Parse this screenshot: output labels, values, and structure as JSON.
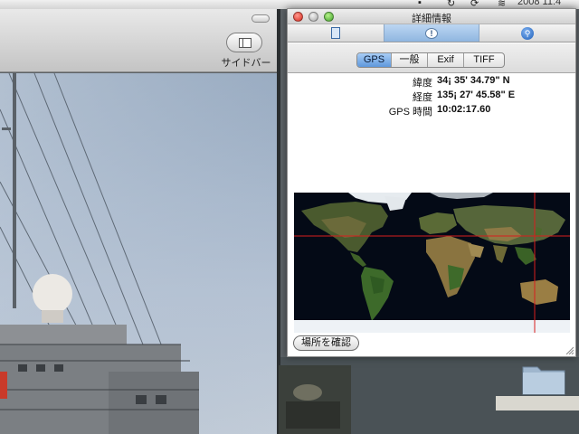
{
  "menubar": {
    "clock": "2008 11:4"
  },
  "preview": {
    "sidebar_label": "サイドバー"
  },
  "inspector": {
    "title": "詳細情報",
    "tabs": [
      "general-info",
      "more-info",
      "keywords"
    ],
    "segments": [
      {
        "label": "GPS",
        "active": true
      },
      {
        "label": "一般",
        "active": false
      },
      {
        "label": "Exif",
        "active": false
      },
      {
        "label": "TIFF",
        "active": false
      }
    ],
    "gps": [
      {
        "key": "緯度",
        "value": "34¡ 35' 34.79\" N"
      },
      {
        "key": "経度",
        "value": "135¡ 27' 45.58\" E"
      },
      {
        "key": "GPS 時間",
        "value": "10:02:17.60"
      }
    ],
    "locate_button": "場所を確認"
  },
  "colors": {
    "map_ocean": "#040a16",
    "crosshair": "#d81e1e",
    "selected_tab": "#8fb6e0"
  }
}
